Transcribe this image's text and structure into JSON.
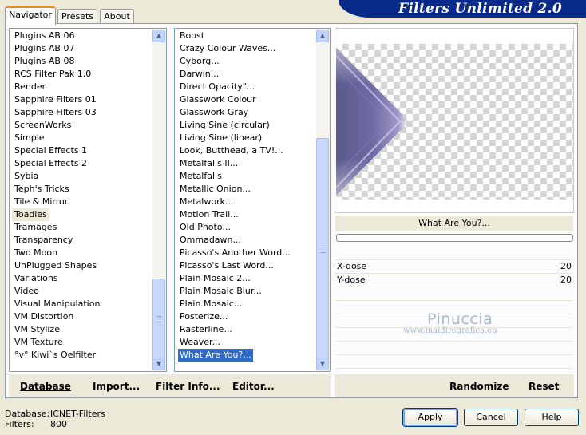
{
  "app": {
    "title": "Filters Unlimited 2.0"
  },
  "tabs": [
    {
      "label": "Navigator",
      "active": true
    },
    {
      "label": "Presets",
      "active": false
    },
    {
      "label": "About",
      "active": false
    }
  ],
  "categories": {
    "items": [
      "Plugins AB 06",
      "Plugins AB 07",
      "Plugins AB 08",
      "RCS Filter Pak 1.0",
      "Render",
      "Sapphire Filters 01",
      "Sapphire Filters 03",
      "ScreenWorks",
      "Simple",
      "Special Effects 1",
      "Special Effects 2",
      "Sybia",
      "Teph's Tricks",
      "Tile & Mirror",
      "Toadies",
      "Tramages",
      "Transparency",
      "Two Moon",
      "UnPlugged Shapes",
      "Variations",
      "Video",
      "Visual Manipulation",
      "VM Distortion",
      "VM Stylize",
      "VM Texture",
      "°v° Kiwi`s Oelfilter"
    ],
    "highlighted": "Toadies"
  },
  "filters": {
    "items": [
      "Boost",
      "Crazy Colour Waves...",
      "Cyborg...",
      "Darwin...",
      "Direct Opacity\"...",
      "Glasswork Colour",
      "Glasswork Gray",
      "Living Sine (circular)",
      "Living Sine (linear)",
      "Look, Butthead, a TV!...",
      "Metalfalls II...",
      "Metalfalls",
      "Metallic Onion...",
      "Metalwork...",
      "Motion Trail...",
      "Old Photo...",
      "Ommadawn...",
      "Picasso's Another Word...",
      "Picasso's Last Word...",
      "Plain Mosaic 2...",
      "Plain Mosaic Blur...",
      "Plain Mosaic...",
      "Posterize...",
      "Rasterline...",
      "Weaver...",
      "What Are You?..."
    ],
    "selected": "What Are You?..."
  },
  "preview": {
    "filter_name": "What Are You?...",
    "progress": 0
  },
  "params": [
    {
      "label": "X-dose",
      "value": "20"
    },
    {
      "label": "Y-dose",
      "value": "20"
    }
  ],
  "watermark": {
    "name": "Pinuccia",
    "url": "www.maidiregrafica.eu"
  },
  "links": {
    "database": "Database",
    "import": "Import...",
    "filter_info": "Filter Info...",
    "editor": "Editor...",
    "randomize": "Randomize",
    "reset": "Reset"
  },
  "status": {
    "database_label": "Database:",
    "database_value": "ICNET-Filters",
    "filters_label": "Filters:",
    "filters_value": "800"
  },
  "buttons": {
    "apply": "Apply",
    "cancel": "Cancel",
    "help": "Help"
  },
  "colors": {
    "selection": "#316ac5",
    "banner": "#0a2a8a",
    "tab_accent": "#e68b2c"
  }
}
